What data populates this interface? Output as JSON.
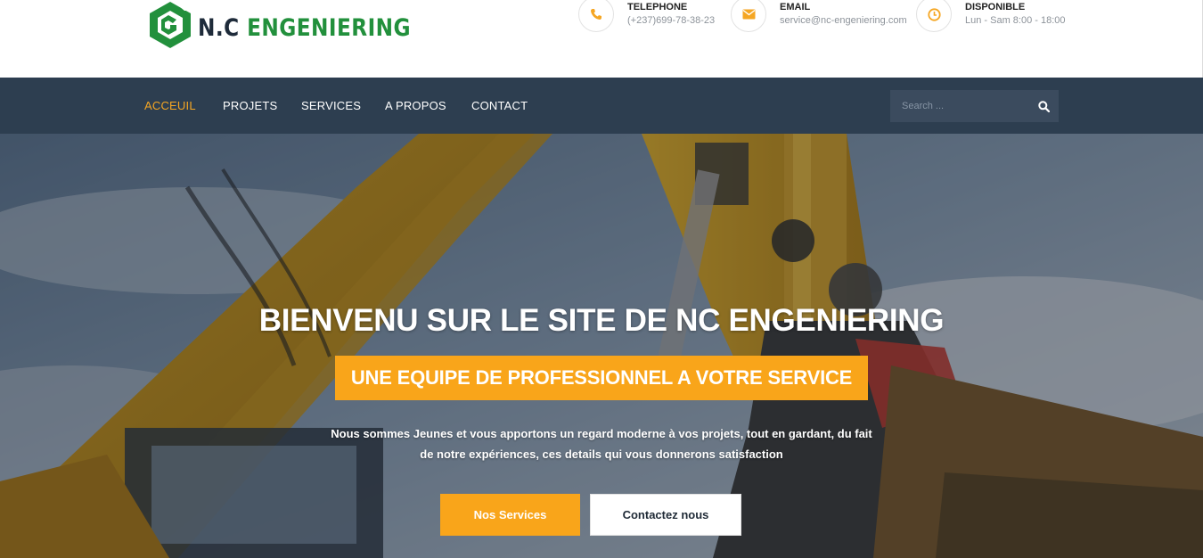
{
  "brand": {
    "name_part1": "N.C",
    "name_part2": "ENGENIERING",
    "colors": {
      "green": "#22903c",
      "navy": "#1e2b3a"
    }
  },
  "contact_info": [
    {
      "icon": "phone-icon",
      "label": "TELEPHONE",
      "value": "(+237)699-78-38-23"
    },
    {
      "icon": "envelope-icon",
      "label": "EMAIL",
      "value": "service@nc-engeniering.com"
    },
    {
      "icon": "clock-icon",
      "label": "DISPONIBLE",
      "value": "Lun - Sam 8:00 - 18:00"
    }
  ],
  "nav": {
    "items": [
      {
        "label": "ACCEUIL",
        "active": true
      },
      {
        "label": "PROJETS",
        "active": false
      },
      {
        "label": "SERVICES",
        "active": false
      },
      {
        "label": "A PROPOS",
        "active": false
      },
      {
        "label": "CONTACT",
        "active": false
      }
    ],
    "search": {
      "placeholder": "Search ...",
      "icon": "search-icon"
    }
  },
  "hero": {
    "title": "BIENVENU SUR LE SITE DE NC ENGENIERING",
    "subtitle": "UNE EQUIPE DE PROFESSIONNEL A VOTRE SERVICE",
    "description_line1": "Nous sommes Jeunes et vous apportons un regard moderne à vos projets, tout en gardant, du fait",
    "description_line2": "de notre expériences, ces details qui vous donnerons satisfaction",
    "buttons": {
      "primary": "Nos Services",
      "secondary": "Contactez nous"
    }
  },
  "colors": {
    "accent": "#f9a51a",
    "nav_bg": "#2d3e50",
    "nav_active": "#f5a623"
  }
}
